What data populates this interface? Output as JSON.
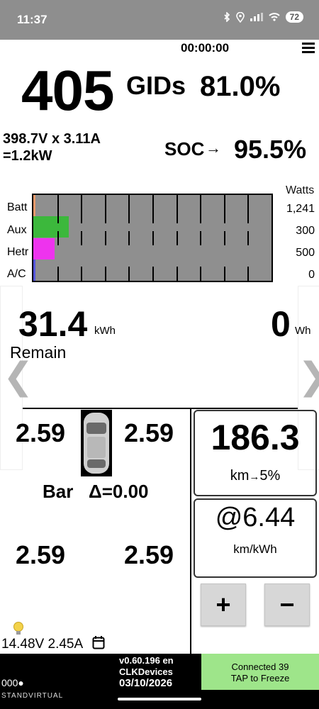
{
  "status_bar": {
    "time": "11:37",
    "battery": "72"
  },
  "header": {
    "timer": "00:00:00"
  },
  "gids": {
    "value": "405",
    "label": "GIDs",
    "percent": "81.0%"
  },
  "power": {
    "line1": "398.7V x 3.11A",
    "line2": "=1.2kW"
  },
  "soc": {
    "label": "SOC",
    "arrow": "→",
    "value": "95.5%"
  },
  "power_chart": {
    "watts_header": "Watts",
    "rows": [
      {
        "label": "Batt",
        "watts": "1,241",
        "fill_fraction": 0.007,
        "color": "#e89a6a"
      },
      {
        "label": "Aux",
        "watts": "300",
        "fill_fraction": 0.15,
        "color": "#3cb83c"
      },
      {
        "label": "Hetr",
        "watts": "500",
        "fill_fraction": 0.09,
        "color": "#ee33ee"
      },
      {
        "label": "A/C",
        "watts": "0",
        "fill_fraction": 0.0,
        "color": "#5555dd"
      }
    ]
  },
  "energy": {
    "remain_value": "31.4",
    "remain_unit": "kWh",
    "remain_label": "Remain",
    "wh_value": "0",
    "wh_unit": "Wh"
  },
  "tires": {
    "fl": "2.59",
    "fr": "2.59",
    "rl": "2.59",
    "rr": "2.59",
    "label": "Bar",
    "delta": "Δ=0.00"
  },
  "range": {
    "value": "186.3",
    "unit": "km",
    "arrow": "→",
    "reserve": "5%"
  },
  "efficiency": {
    "value": "@6.44",
    "unit": "km/kWh"
  },
  "buttons": {
    "plus": "+",
    "minus": "−"
  },
  "aux_battery": {
    "text": "14.48V 2.45A"
  },
  "footer": {
    "version_line1": "v0.60.196 en",
    "version_line2": "CLKDevices",
    "version_line3": "03/10/2026",
    "connection_line1": "Connected 39",
    "connection_line2": "TAP to Freeze",
    "left_text": "000●",
    "watermark": "STANDVIRTUAL"
  }
}
